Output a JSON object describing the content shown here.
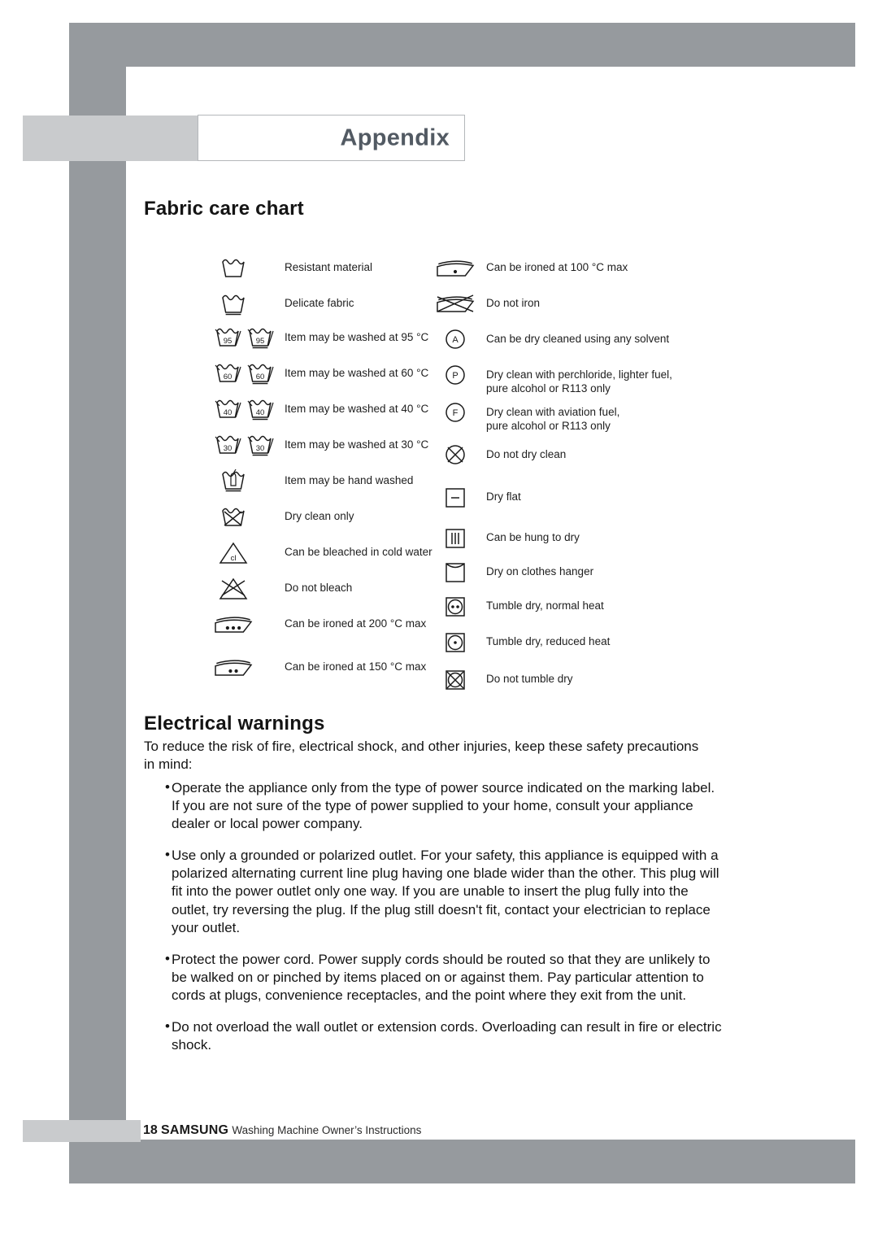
{
  "page": {
    "tab_title": "Appendix",
    "frame_color": "#969a9e",
    "tab_band_color": "#c9cbcd"
  },
  "sections": {
    "fabric": {
      "title": "Fabric care chart"
    },
    "electrical": {
      "title": "Electrical warnings",
      "intro": "To reduce the risk of fire, electrical shock, and other injuries, keep these safety precautions in mind:",
      "bullet_marker": "•",
      "bullets": [
        "Operate the appliance only from the type of power source indicated on the marking label.  If you are not sure of the type of power supplied to your home, consult your appliance dealer or local power company.",
        "Use only a grounded or polarized outlet.  For your safety, this appliance is equipped with a polarized alternating current line plug having one blade wider than the other.  This plug will fit into the power outlet only one way.  If you are unable to insert the plug fully into the outlet, try reversing the plug.  If the plug still doesn't fit, contact your electrician to replace your outlet.",
        "Protect the power cord. Power supply cords should be routed so that they are unlikely to be walked on or pinched by items placed on or against them.  Pay particular attention to cords at plugs, convenience receptacles, and the point where they exit from the unit.",
        "Do not overload the wall outlet or extension cords.  Overloading can result in fire or electric shock."
      ]
    }
  },
  "fabric_symbols": {
    "left_column": [
      {
        "icon": "wash-tub",
        "label": "Resistant material"
      },
      {
        "icon": "wash-tub-underline",
        "label": "Delicate fabric"
      },
      {
        "icon": "wash-tub-95-pair",
        "label": "Item may be washed at 95 °C"
      },
      {
        "icon": "wash-tub-60-pair",
        "label": "Item may be washed at 60 °C"
      },
      {
        "icon": "wash-tub-40-pair",
        "label": "Item may be washed at 40 °C"
      },
      {
        "icon": "wash-tub-30-pair",
        "label": "Item may be washed at 30 °C"
      },
      {
        "icon": "hand-wash-tub",
        "label": "Item may be hand washed"
      },
      {
        "icon": "dry-clean-only-tub-crossed",
        "label": "Dry clean only"
      },
      {
        "icon": "bleach-triangle-cl",
        "label": "Can be bleached in cold water"
      },
      {
        "icon": "do-not-bleach-triangle",
        "label": "Do not bleach"
      },
      {
        "icon": "iron-three-dots",
        "label": "Can be ironed at 200 °C max"
      },
      {
        "icon": "iron-two-dots",
        "label": "Can be ironed at 150 °C max"
      }
    ],
    "right_column": [
      {
        "icon": "iron-one-dot",
        "label": "Can be ironed at 100 °C  max"
      },
      {
        "icon": "do-not-iron",
        "label": "Do not iron"
      },
      {
        "icon": "circle-a",
        "label": "Can be dry cleaned using any solvent"
      },
      {
        "icon": "circle-p",
        "label": "Dry clean with perchloride, lighter fuel,\npure alcohol or R113 only"
      },
      {
        "icon": "circle-f",
        "label": "Dry clean with aviation fuel,\npure alcohol or R113 only"
      },
      {
        "icon": "do-not-dry-clean-circle-crossed",
        "label": "Do not dry clean"
      },
      {
        "icon": "dry-flat-square",
        "label": "Dry flat"
      },
      {
        "icon": "hang-to-dry-square",
        "label": "Can be hung to dry"
      },
      {
        "icon": "clothes-hanger-square",
        "label": "Dry on clothes hanger"
      },
      {
        "icon": "tumble-dry-two-dots",
        "label": " Tumble dry, normal heat"
      },
      {
        "icon": "tumble-dry-one-dot",
        "label": "Tumble dry, reduced heat"
      },
      {
        "icon": "do-not-tumble-dry",
        "label": "Do not tumble dry"
      }
    ]
  },
  "tub_temperatures": {
    "t95": "95",
    "t60": "60",
    "t40": "40",
    "t30": "30"
  },
  "circle_letters": {
    "any_solvent": "A",
    "perchloride": "P",
    "aviation": "F"
  },
  "bleach_label": "cl",
  "footer": {
    "page_number": "18",
    "brand": "SAMSUNG",
    "subtitle": "Washing Machine Owner’s Instructions"
  }
}
